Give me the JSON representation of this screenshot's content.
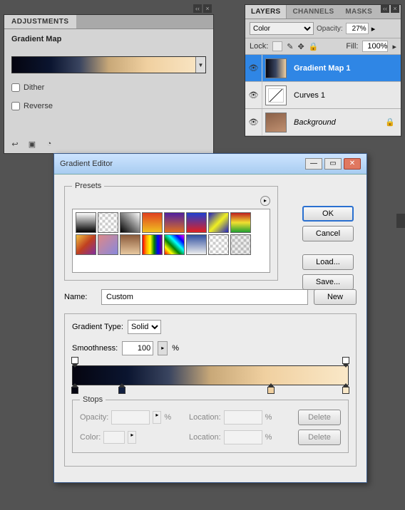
{
  "adjustments": {
    "tab": "ADJUSTMENTS",
    "title": "Gradient Map",
    "dither": "Dither",
    "reverse": "Reverse"
  },
  "layers": {
    "tabs": {
      "layers": "LAYERS",
      "channels": "CHANNELS",
      "masks": "MASKS"
    },
    "blendMode": "Color",
    "opacityLabel": "Opacity:",
    "opacityValue": "27%",
    "lockLabel": "Lock:",
    "fillLabel": "Fill:",
    "fillValue": "100%",
    "items": [
      {
        "name": "Gradient Map 1",
        "selected": true,
        "italic": false,
        "locked": false,
        "thumb": "grad"
      },
      {
        "name": "Curves 1",
        "selected": false,
        "italic": false,
        "locked": false,
        "thumb": "curves"
      },
      {
        "name": "Background",
        "selected": false,
        "italic": true,
        "locked": true,
        "thumb": "bg"
      }
    ]
  },
  "dialog": {
    "title": "Gradient Editor",
    "presetsLegend": "Presets",
    "buttons": {
      "ok": "OK",
      "cancel": "Cancel",
      "load": "Load...",
      "save": "Save...",
      "new": "New"
    },
    "nameLabel": "Name:",
    "nameValue": "Custom",
    "gradientTypeLabel": "Gradient Type:",
    "gradientTypeValue": "Solid",
    "smoothnessLabel": "Smoothness:",
    "smoothnessValue": "100",
    "pct": "%",
    "stops": {
      "legend": "Stops",
      "opacity": "Opacity:",
      "location": "Location:",
      "color": "Color:",
      "delete": "Delete"
    },
    "gradientStops": {
      "colorStops": [
        {
          "pos": 1,
          "color": "#050510"
        },
        {
          "pos": 18,
          "color": "#122040"
        },
        {
          "pos": 72,
          "color": "#f0d0a0"
        },
        {
          "pos": 99,
          "color": "#fae8c8"
        }
      ],
      "opacityStops": [
        {
          "pos": 1
        },
        {
          "pos": 99
        }
      ]
    }
  }
}
